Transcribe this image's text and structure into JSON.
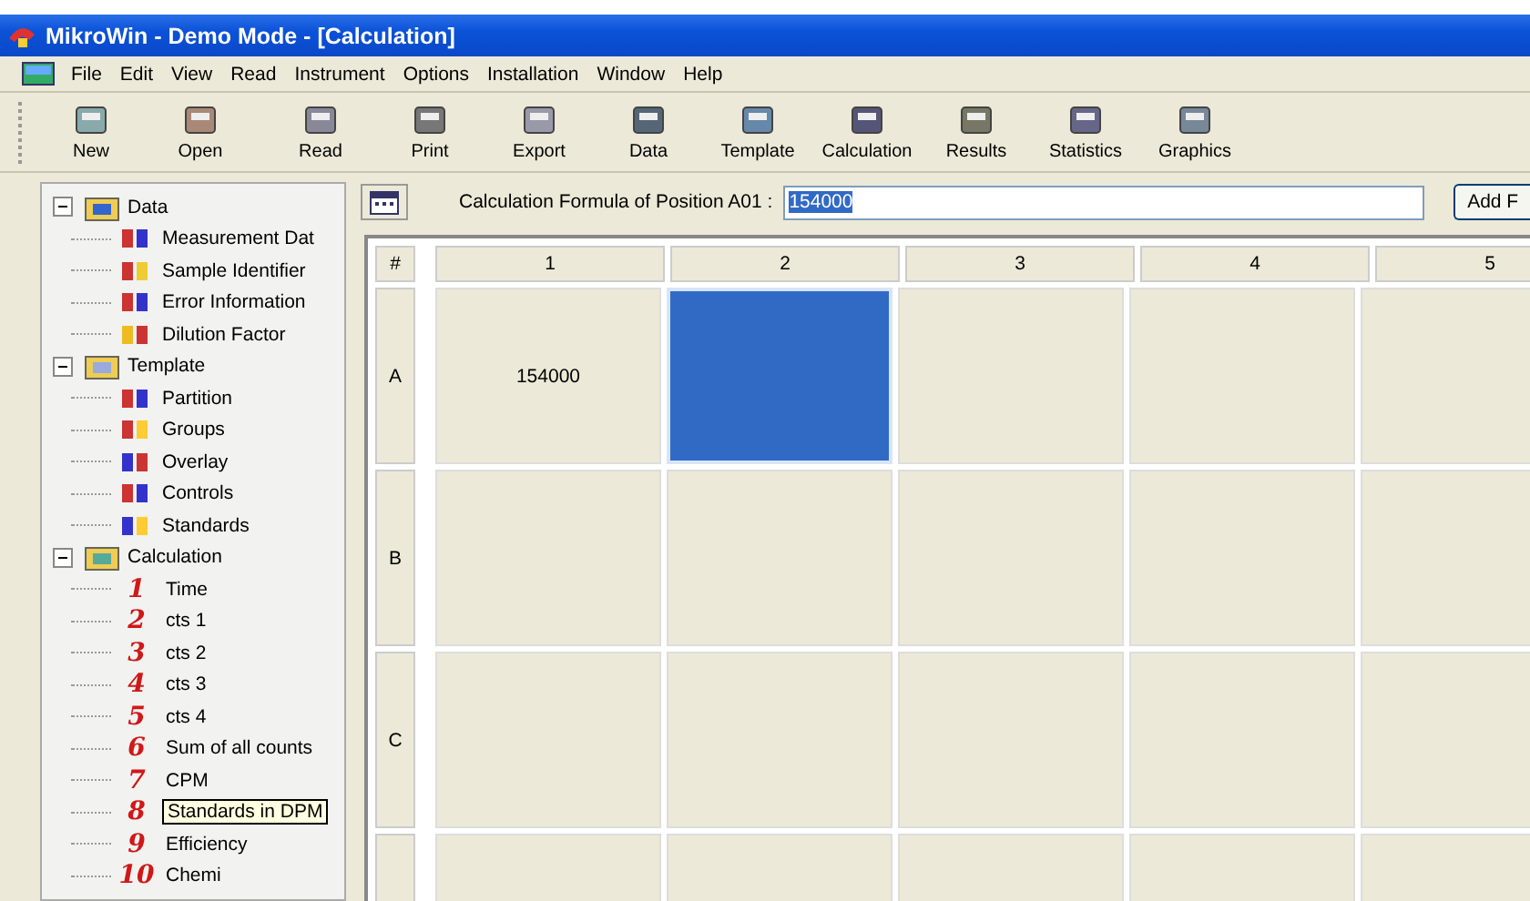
{
  "window": {
    "title": "MikroWin - Demo Mode - [Calculation]"
  },
  "menu": [
    "File",
    "Edit",
    "View",
    "Read",
    "Instrument",
    "Options",
    "Installation",
    "Window",
    "Help"
  ],
  "toolbar": [
    "New",
    "Open",
    "Read",
    "Print",
    "Export",
    "Data",
    "Template",
    "Calculation",
    "Results",
    "Statistics",
    "Graphics"
  ],
  "tree": [
    {
      "label": "Data",
      "expanded": true,
      "children": [
        {
          "label": "Measurement Dat"
        },
        {
          "label": "Sample Identifier"
        },
        {
          "label": "Error Information"
        },
        {
          "label": "Dilution Factor"
        }
      ]
    },
    {
      "label": "Template",
      "expanded": true,
      "children": [
        {
          "label": "Partition"
        },
        {
          "label": "Groups"
        },
        {
          "label": "Overlay"
        },
        {
          "label": "Controls"
        },
        {
          "label": "Standards"
        }
      ]
    },
    {
      "label": "Calculation",
      "expanded": true,
      "children": [
        {
          "number": "1",
          "label": "Time",
          "tooltip": false
        },
        {
          "number": "2",
          "label": "cts 1",
          "tooltip": false
        },
        {
          "number": "3",
          "label": "cts 2",
          "tooltip": false
        },
        {
          "number": "4",
          "label": "cts 3",
          "tooltip": false
        },
        {
          "number": "5",
          "label": "cts 4",
          "tooltip": false
        },
        {
          "number": "6",
          "label": "Sum of all counts",
          "tooltip": false
        },
        {
          "number": "7",
          "label": "CPM",
          "tooltip": false
        },
        {
          "number": "8",
          "label": "Standards in DPM",
          "tooltip": true
        },
        {
          "number": "9",
          "label": "Efficiency",
          "tooltip": false
        },
        {
          "number": "10",
          "label": "Chemi",
          "tooltip": false
        }
      ]
    }
  ],
  "formula": {
    "label": "Calculation Formula of Position A01 :",
    "value": "154000",
    "button": "Add F"
  },
  "grid": {
    "corner": "#",
    "columns": [
      "1",
      "2",
      "3",
      "4",
      "5"
    ],
    "rows": [
      {
        "label": "A",
        "cells": [
          {
            "value": "154000",
            "selected": false
          },
          {
            "selected": true
          },
          {
            "selected": false
          },
          {
            "selected": false
          },
          {
            "selected": false
          }
        ]
      },
      {
        "label": "B",
        "cells": [
          {
            "selected": false
          },
          {
            "selected": false
          },
          {
            "selected": false
          },
          {
            "selected": false
          },
          {
            "selected": false
          }
        ]
      },
      {
        "label": "C",
        "cells": [
          {
            "selected": false
          },
          {
            "selected": false
          },
          {
            "selected": false
          },
          {
            "selected": false
          },
          {
            "selected": false
          }
        ]
      }
    ]
  }
}
